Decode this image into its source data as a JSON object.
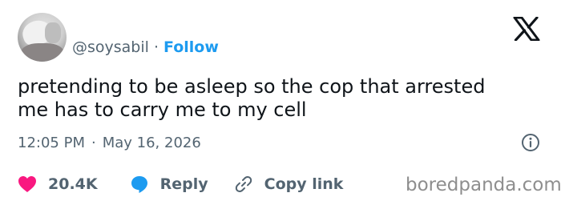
{
  "author": {
    "handle": "@soysabil",
    "separator": "·",
    "follow_label": "Follow"
  },
  "tweet": {
    "text": "pretending to be asleep so the cop that arrested\nme has to carry me to my cell",
    "time": "12:05 PM",
    "separator": "·",
    "date": "May 16, 2026"
  },
  "actions": {
    "likes": "20.4K",
    "reply_label": "Reply",
    "copy_link_label": "Copy link"
  },
  "watermark": "boredpanda.com",
  "icons": {
    "platform": "x-logo-icon",
    "info": "info-icon",
    "like": "heart-icon",
    "reply": "speech-bubble-icon",
    "copy": "link-icon"
  },
  "colors": {
    "accent": "#1d9bf0",
    "heart": "#f91880",
    "text_primary": "#0f1419",
    "text_secondary": "#536471"
  }
}
